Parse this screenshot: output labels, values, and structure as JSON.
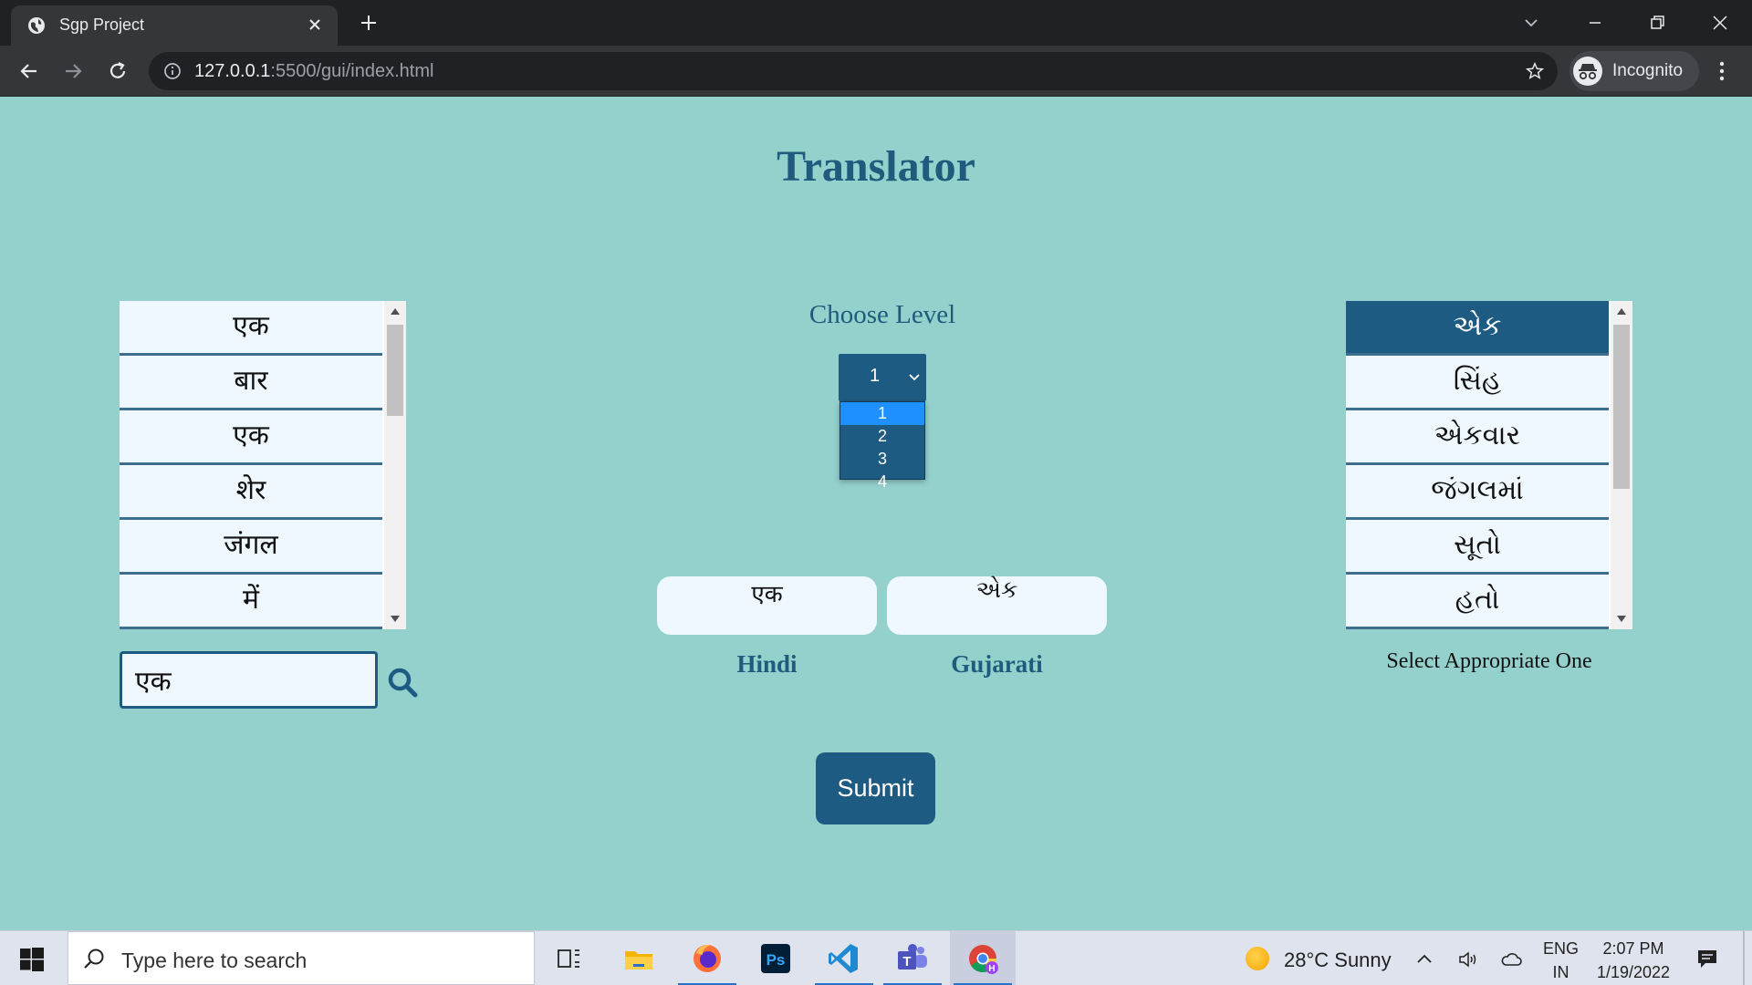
{
  "browser": {
    "tab_title": "Sgp Project",
    "url_host": "127.0.0.1",
    "url_rest": ":5500/gui/index.html",
    "profile_label": "Incognito"
  },
  "page": {
    "title": "Translator",
    "hindi_words": [
      "एक",
      "बार",
      "एक",
      "शेर",
      "जंगल",
      "में"
    ],
    "gujarati_words": [
      "એક",
      "સિંહ",
      "એકવાર",
      "જંગલમાં",
      "સૂતો",
      "હતો"
    ],
    "gujarati_selected_index": 0,
    "search_value": "एक",
    "choose_level_label": "Choose Level",
    "level_selected": "1",
    "level_options": [
      "1",
      "2",
      "3",
      "4"
    ],
    "hindi_output": "एक",
    "gujarati_output": "એક",
    "hindi_label": "Hindi",
    "gujarati_label": "Gujarati",
    "select_hint": "Select Appropriate One",
    "submit_label": "Submit"
  },
  "taskbar": {
    "search_placeholder": "Type here to search",
    "weather": "28°C  Sunny",
    "lang_line1": "ENG",
    "lang_line2": "IN",
    "time": "2:07 PM",
    "date": "1/19/2022"
  },
  "colors": {
    "page_bg": "#94d1cc",
    "accent": "#1e5b82",
    "title_text": "#215a7c"
  }
}
